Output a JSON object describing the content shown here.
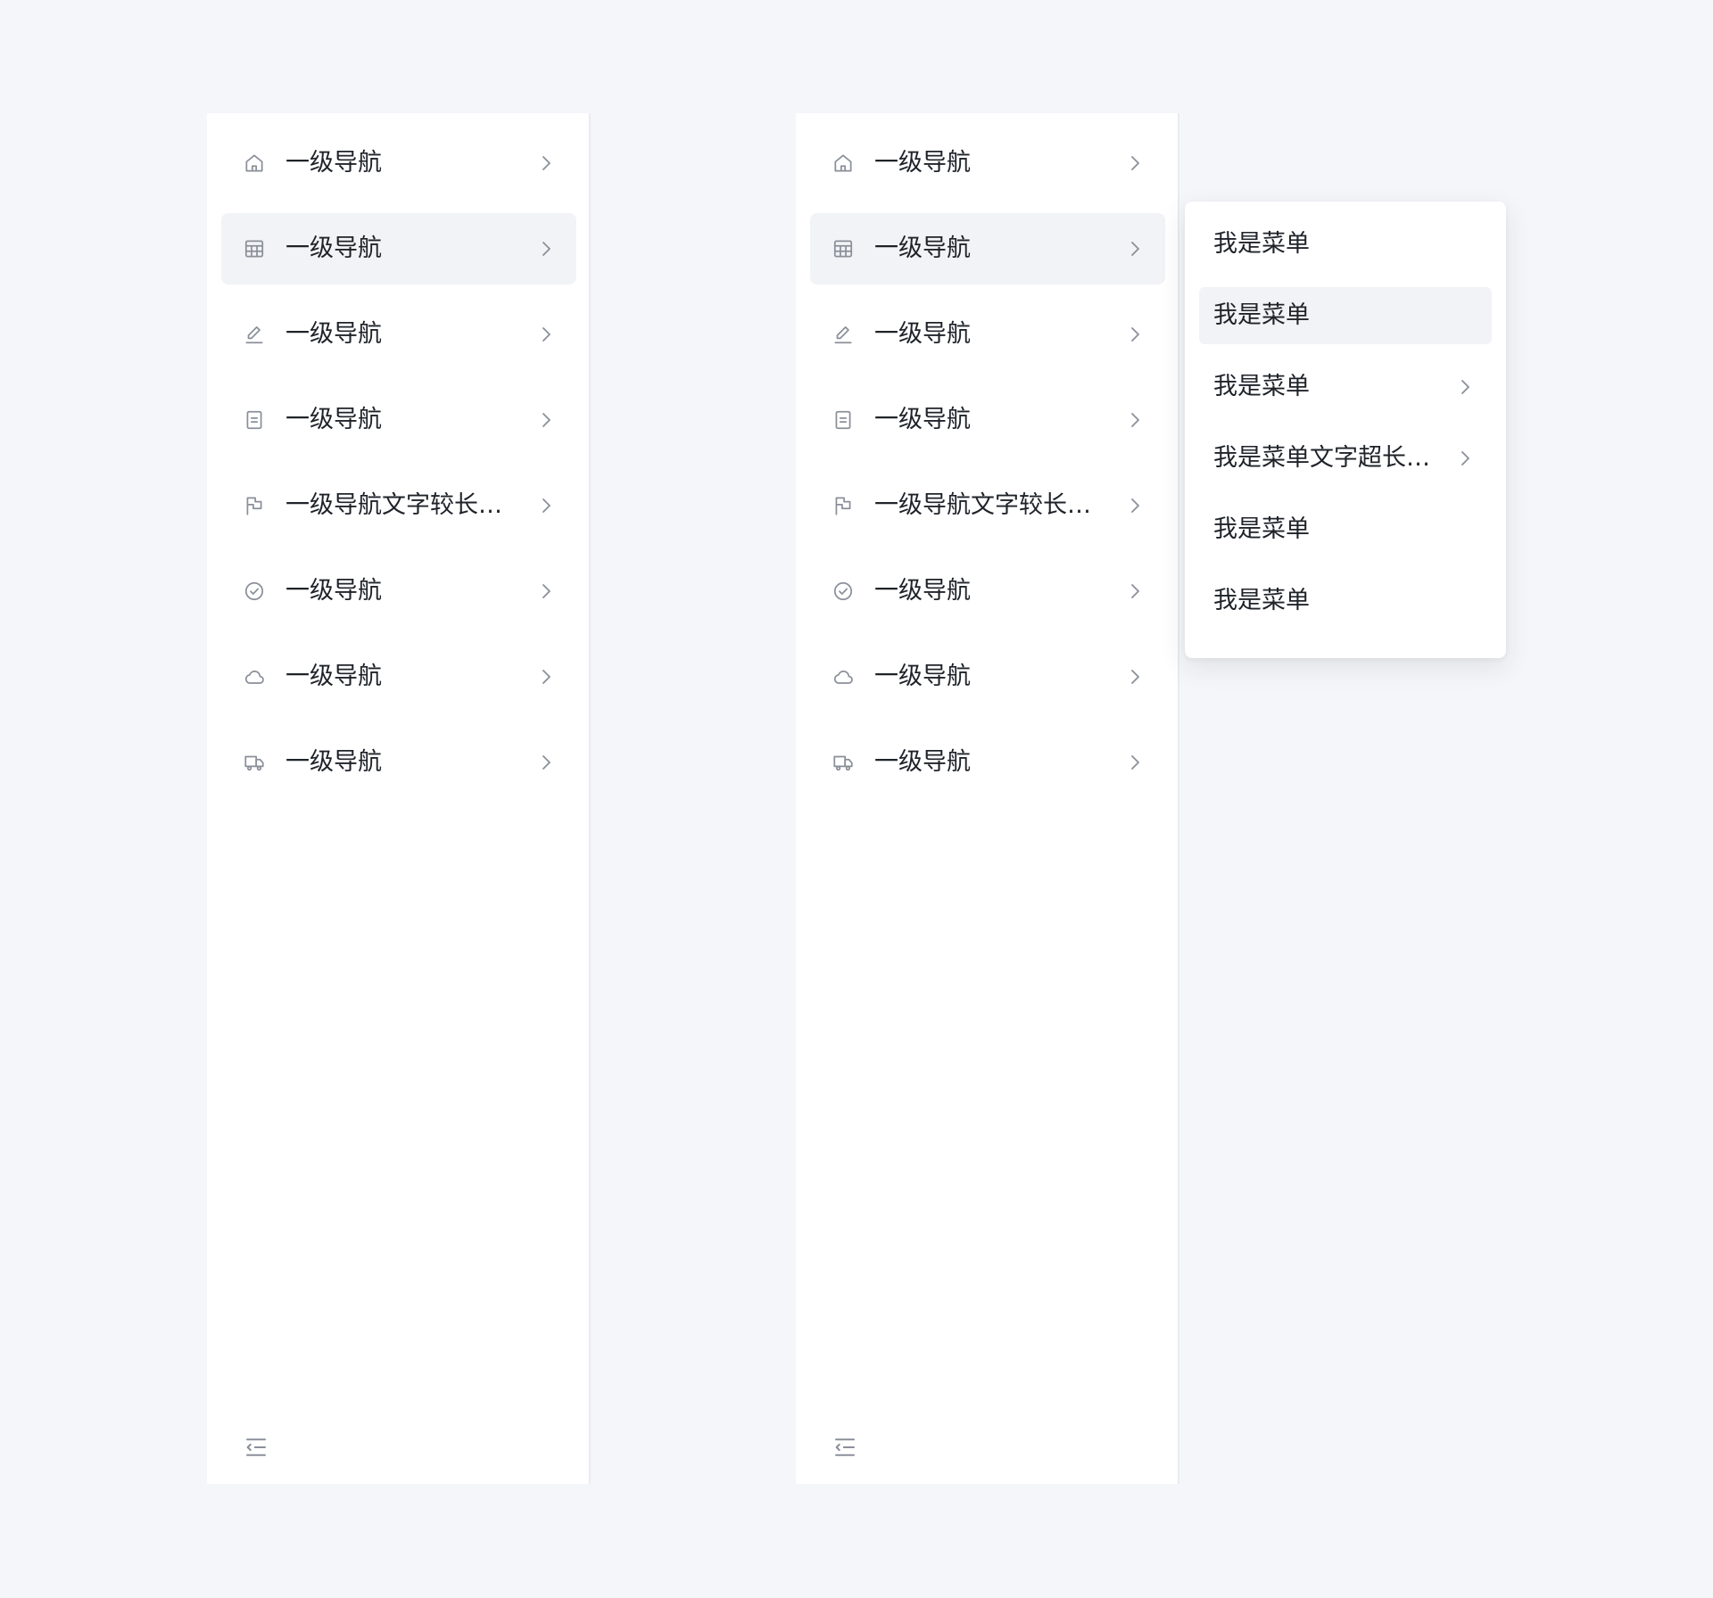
{
  "colors": {
    "page_background": "#f5f6fa",
    "panel_background": "#ffffff",
    "active_background": "#f2f3f6",
    "text": "#1f2329",
    "icon": "#8a8f99"
  },
  "sidebars": [
    {
      "items": [
        {
          "icon": "home-icon",
          "label": "一级导航",
          "active": false
        },
        {
          "icon": "table-icon",
          "label": "一级导航",
          "active": true
        },
        {
          "icon": "edit-icon",
          "label": "一级导航",
          "active": false
        },
        {
          "icon": "document-icon",
          "label": "一级导航",
          "active": false
        },
        {
          "icon": "flag-icon",
          "label": "一级导航文字较长…",
          "active": false
        },
        {
          "icon": "check-circle-icon",
          "label": "一级导航",
          "active": false
        },
        {
          "icon": "cloud-icon",
          "label": "一级导航",
          "active": false
        },
        {
          "icon": "truck-icon",
          "label": "一级导航",
          "active": false
        }
      ],
      "footer_icon": "collapse-menu-icon"
    },
    {
      "items": [
        {
          "icon": "home-icon",
          "label": "一级导航",
          "active": false
        },
        {
          "icon": "table-icon",
          "label": "一级导航",
          "active": true
        },
        {
          "icon": "edit-icon",
          "label": "一级导航",
          "active": false
        },
        {
          "icon": "document-icon",
          "label": "一级导航",
          "active": false
        },
        {
          "icon": "flag-icon",
          "label": "一级导航文字较长…",
          "active": false
        },
        {
          "icon": "check-circle-icon",
          "label": "一级导航",
          "active": false
        },
        {
          "icon": "cloud-icon",
          "label": "一级导航",
          "active": false
        },
        {
          "icon": "truck-icon",
          "label": "一级导航",
          "active": false
        }
      ],
      "footer_icon": "collapse-menu-icon"
    }
  ],
  "popup_menu": {
    "items": [
      {
        "label": "我是菜单",
        "active": false,
        "has_submenu": false
      },
      {
        "label": "我是菜单",
        "active": true,
        "has_submenu": false
      },
      {
        "label": "我是菜单",
        "active": false,
        "has_submenu": true
      },
      {
        "label": "我是菜单文字超长…",
        "active": false,
        "has_submenu": true
      },
      {
        "label": "我是菜单",
        "active": false,
        "has_submenu": false
      },
      {
        "label": "我是菜单",
        "active": false,
        "has_submenu": false
      }
    ]
  }
}
